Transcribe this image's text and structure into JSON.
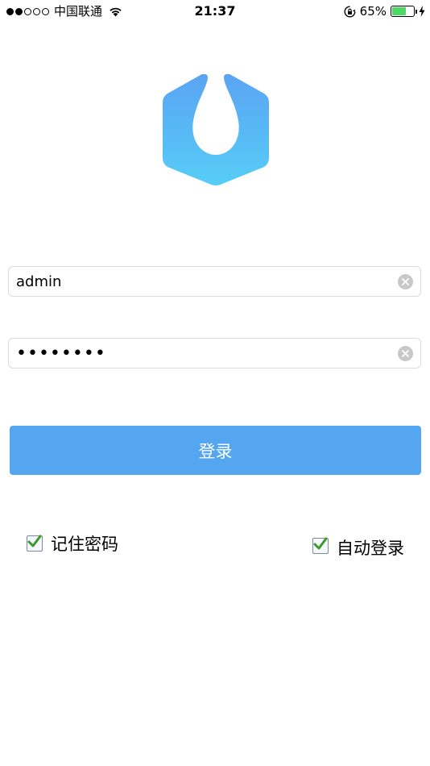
{
  "status_bar": {
    "carrier": "中国联通",
    "time": "21:37",
    "battery_percent": "65%",
    "battery_level": 0.65,
    "signal_bars_filled": 2,
    "signal_bars_total": 5
  },
  "login_form": {
    "username_value": "admin",
    "password_value": "••••••••",
    "login_button_label": "登录"
  },
  "options": {
    "remember_password": {
      "label": "记住密码",
      "checked": true
    },
    "auto_login": {
      "label": "自动登录",
      "checked": true
    }
  },
  "colors": {
    "accent": "#55a6f1",
    "logo_top": "#5aa4f3",
    "logo_bottom": "#56cdf7",
    "checkmark": "#3c9a2a",
    "battery": "#4cd964"
  }
}
